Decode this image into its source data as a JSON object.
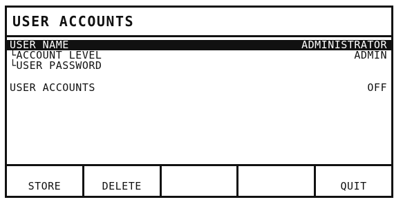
{
  "screen": {
    "title": "USER ACCOUNTS"
  },
  "rows": [
    {
      "label": "USER NAME",
      "value": "ADMINISTRATOR",
      "selected": true
    },
    {
      "label": "└ACCOUNT LEVEL",
      "value": "ADMIN"
    },
    {
      "label": "└USER PASSWORD",
      "value": ""
    },
    {
      "label": "USER ACCOUNTS",
      "value": "OFF"
    }
  ],
  "softkeys": [
    "STORE",
    "DELETE",
    "",
    "",
    "QUIT"
  ]
}
